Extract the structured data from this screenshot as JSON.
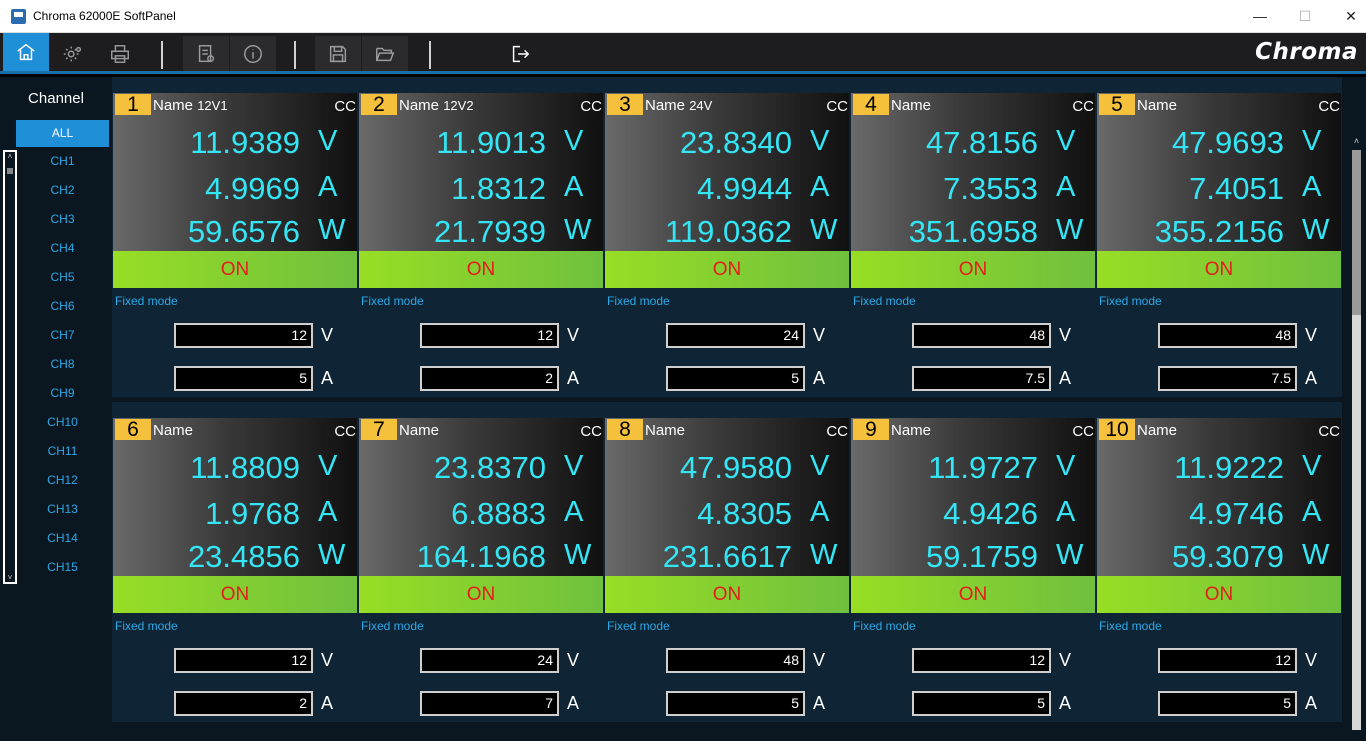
{
  "window": {
    "title": "Chroma 62000E SoftPanel",
    "min": "—",
    "max": "☐",
    "close": "✕"
  },
  "toolbar": {
    "brand": "Chroma",
    "icons": [
      "home-icon",
      "settings-icon",
      "print-icon",
      "script-icon",
      "info-icon",
      "save-icon",
      "open-folder-icon",
      "exit-icon"
    ]
  },
  "sidebar": {
    "heading": "Channel",
    "all_label": "ALL",
    "channels": [
      "CH1",
      "CH2",
      "CH3",
      "CH4",
      "CH5",
      "CH6",
      "CH7",
      "CH8",
      "CH9",
      "CH10",
      "CH11",
      "CH12",
      "CH13",
      "CH14",
      "CH15"
    ]
  },
  "labels": {
    "name": "Name",
    "fixed_mode": "Fixed mode",
    "on": "ON",
    "unit_v": "V",
    "unit_a": "A",
    "unit_w": "W"
  },
  "channels": [
    {
      "num": "1",
      "name": "12V1",
      "mode": "CC",
      "volt": "11.9389",
      "amp": "4.9969",
      "watt": "59.6576",
      "set_v": "12",
      "set_a": "5"
    },
    {
      "num": "2",
      "name": "12V2",
      "mode": "CC",
      "volt": "11.9013",
      "amp": "1.8312",
      "watt": "21.7939",
      "set_v": "12",
      "set_a": "2"
    },
    {
      "num": "3",
      "name": "24V",
      "mode": "CC",
      "volt": "23.8340",
      "amp": "4.9944",
      "watt": "119.0362",
      "set_v": "24",
      "set_a": "5"
    },
    {
      "num": "4",
      "name": "",
      "mode": "CC",
      "volt": "47.8156",
      "amp": "7.3553",
      "watt": "351.6958",
      "set_v": "48",
      "set_a": "7.5"
    },
    {
      "num": "5",
      "name": "",
      "mode": "CC",
      "volt": "47.9693",
      "amp": "7.4051",
      "watt": "355.2156",
      "set_v": "48",
      "set_a": "7.5"
    },
    {
      "num": "6",
      "name": "",
      "mode": "CC",
      "volt": "11.8809",
      "amp": "1.9768",
      "watt": "23.4856",
      "set_v": "12",
      "set_a": "2"
    },
    {
      "num": "7",
      "name": "",
      "mode": "CC",
      "volt": "23.8370",
      "amp": "6.8883",
      "watt": "164.1968",
      "set_v": "24",
      "set_a": "7"
    },
    {
      "num": "8",
      "name": "",
      "mode": "CC",
      "volt": "47.9580",
      "amp": "4.8305",
      "watt": "231.6617",
      "set_v": "48",
      "set_a": "5"
    },
    {
      "num": "9",
      "name": "",
      "mode": "CC",
      "volt": "11.9727",
      "amp": "4.9426",
      "watt": "59.1759",
      "set_v": "12",
      "set_a": "5"
    },
    {
      "num": "10",
      "name": "",
      "mode": "CC",
      "volt": "11.9222",
      "amp": "4.9746",
      "watt": "59.3079",
      "set_v": "12",
      "set_a": "5"
    }
  ]
}
